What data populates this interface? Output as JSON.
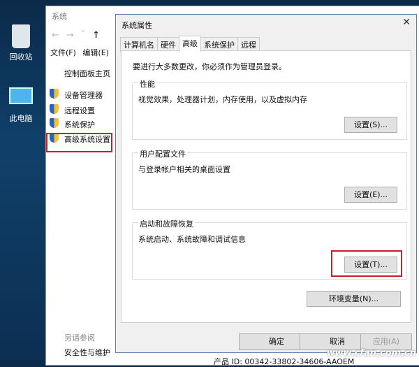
{
  "desktop": {
    "icons": [
      {
        "label": "回收站"
      },
      {
        "label": "此电脑"
      }
    ]
  },
  "explorer": {
    "title": "系统",
    "menu": [
      "文件(F)",
      "编辑(E)"
    ],
    "home": "控制面板主页",
    "links": [
      "设备管理器",
      "远程设置",
      "系统保护",
      "高级系统设置"
    ],
    "see_also": "另请参阅",
    "security": "安全性与维护",
    "product_id": "产品 ID: 00342-33802-34606-AAOEM"
  },
  "dialog": {
    "title": "系统属性",
    "tabs": [
      "计算机名",
      "硬件",
      "高级",
      "系统保护",
      "远程"
    ],
    "admin_note": "要进行大多数更改，你必须作为管理员登录。",
    "performance": {
      "label": "性能",
      "desc": "视觉效果，处理器计划，内存使用，以及虚拟内存",
      "button": "设置(S)..."
    },
    "profiles": {
      "label": "用户配置文件",
      "desc": "与登录帐户相关的桌面设置",
      "button": "设置(E)..."
    },
    "startup": {
      "label": "启动和故障恢复",
      "desc": "系统启动、系统故障和调试信息",
      "button": "设置(T)..."
    },
    "env_button": "环境变量(N)...",
    "ok": "确定",
    "cancel": "取消",
    "apply": "应用(A)"
  },
  "watermark": "www.cfan.com.cn"
}
